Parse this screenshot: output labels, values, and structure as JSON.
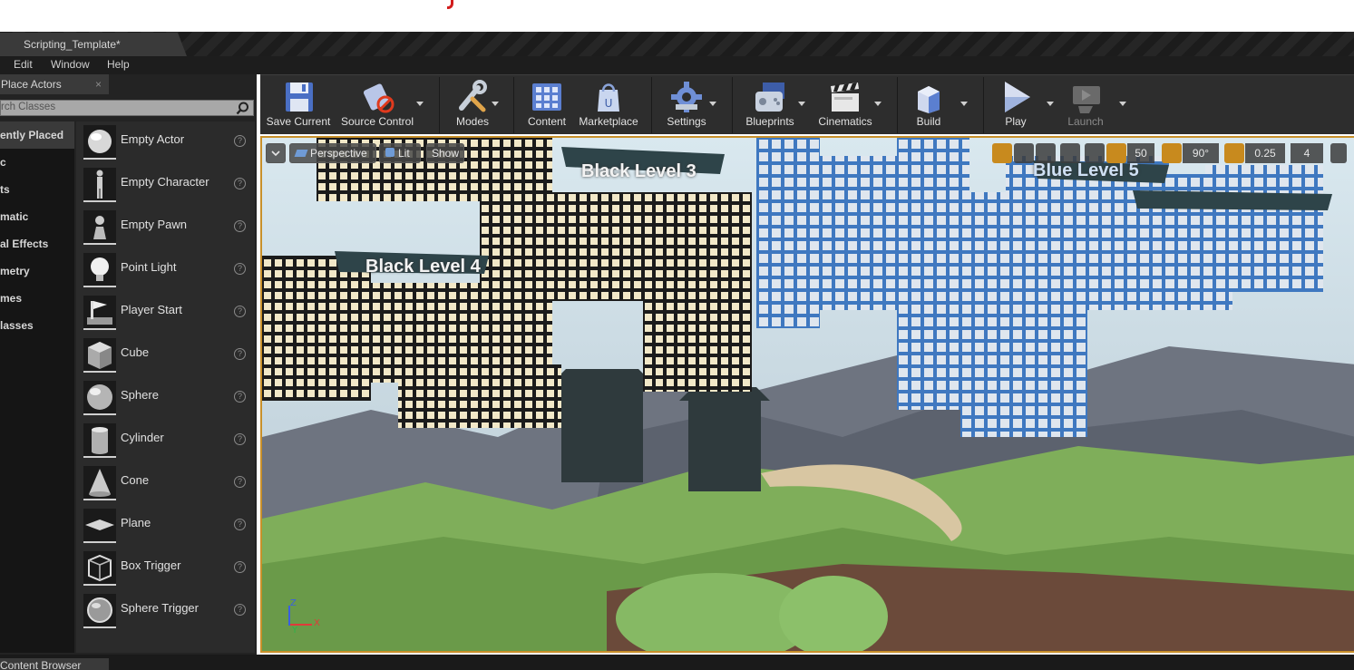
{
  "document_tab": "Scripting_Template*",
  "menu": [
    "Edit",
    "Window",
    "Help"
  ],
  "place_actors": {
    "tab_label": "Place Actors",
    "close": "×",
    "search_placeholder": "rch Classes",
    "categories": [
      "ently Placed",
      "c",
      "ts",
      "matic",
      "al Effects",
      "metry",
      "mes",
      "lasses"
    ],
    "items": [
      {
        "label": "Empty Actor",
        "icon": "empty-actor-icon"
      },
      {
        "label": "Empty Character",
        "icon": "character-icon"
      },
      {
        "label": "Empty Pawn",
        "icon": "pawn-icon"
      },
      {
        "label": "Point Light",
        "icon": "point-light-icon"
      },
      {
        "label": "Player Start",
        "icon": "player-start-icon"
      },
      {
        "label": "Cube",
        "icon": "cube-icon"
      },
      {
        "label": "Sphere",
        "icon": "sphere-icon"
      },
      {
        "label": "Cylinder",
        "icon": "cylinder-icon"
      },
      {
        "label": "Cone",
        "icon": "cone-icon"
      },
      {
        "label": "Plane",
        "icon": "plane-icon"
      },
      {
        "label": "Box Trigger",
        "icon": "box-trigger-icon"
      },
      {
        "label": "Sphere Trigger",
        "icon": "sphere-trigger-icon"
      }
    ],
    "help_glyph": "?"
  },
  "toolbar": {
    "save_current": "Save Current",
    "source_control": "Source Control",
    "modes": "Modes",
    "content": "Content",
    "marketplace": "Marketplace",
    "settings": "Settings",
    "blueprints": "Blueprints",
    "cinematics": "Cinematics",
    "build": "Build",
    "play": "Play",
    "launch": "Launch"
  },
  "viewport": {
    "perspective": "Perspective",
    "lit": "Lit",
    "show": "Show",
    "grid_snap": "50",
    "rotation_snap": "90°",
    "scale_snap": "0.25",
    "camera_speed": "4",
    "level_labels": [
      "Black Level 3",
      "Black Level 4",
      "Blue Level 5"
    ],
    "axis_labels": [
      "Z",
      "X",
      "Y"
    ]
  },
  "content_browser_tab": "Content Browser",
  "colors": {
    "accent_orange": "#c8902a",
    "black_level_tile": "#f2e8c8",
    "blue_level_tile": "#3f78c0",
    "grass": "#7fae5a"
  }
}
